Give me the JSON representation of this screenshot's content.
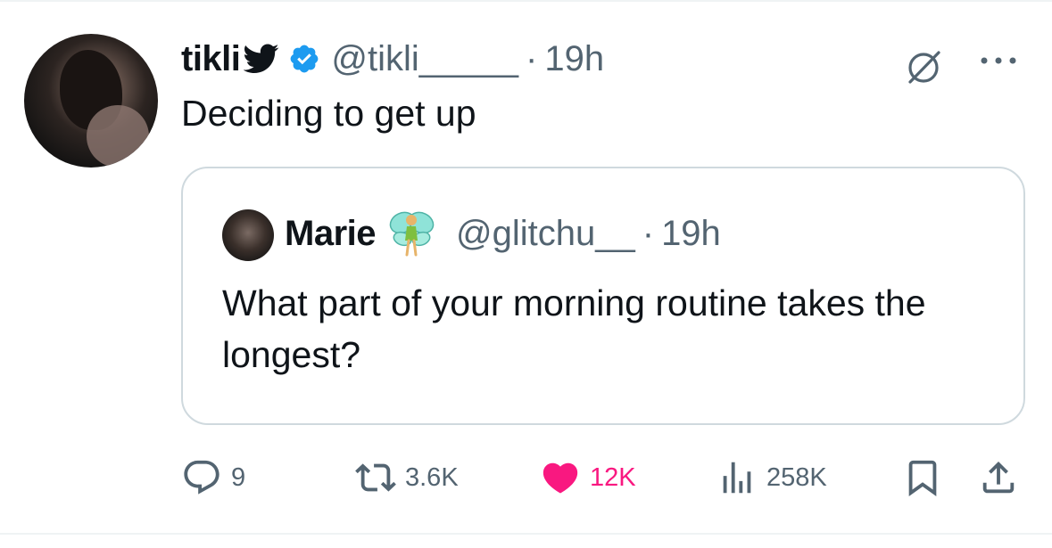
{
  "tweet": {
    "author": {
      "display_name": "tikli",
      "handle": "@tikli_____",
      "verified": true
    },
    "separator": "·",
    "time": "19h",
    "text": "Deciding to get up",
    "quoted": {
      "display_name": "Marie",
      "handle": "@glitchu__",
      "separator": "·",
      "time": "19h",
      "text": "What part of your morning routine takes the longest?"
    },
    "actions": {
      "replies": "9",
      "reposts": "3.6K",
      "likes": "12K",
      "views": "258K"
    }
  },
  "colors": {
    "text": "#0f1419",
    "muted": "#536471",
    "verified": "#1d9bf0",
    "like": "#f91880",
    "border": "#cfd9de"
  },
  "icons": {
    "bird": "bird-icon",
    "verified": "verified-badge-icon",
    "grok": "grok-icon",
    "more": "more-icon",
    "fairy": "fairy-emoji-icon",
    "reply": "reply-icon",
    "repost": "repost-icon",
    "like": "heart-icon",
    "views": "views-icon",
    "bookmark": "bookmark-icon",
    "share": "share-icon"
  }
}
